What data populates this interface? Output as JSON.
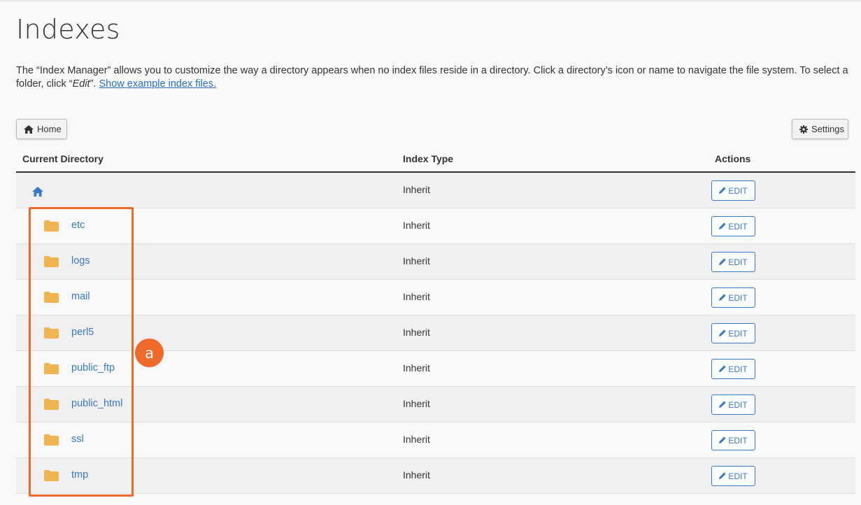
{
  "page": {
    "title": "Indexes",
    "description_line1": "The “Index Manager” allows you to customize the way a directory appears when no index files reside in a directory. Click a directory’s icon or name to navigate the file system. To select a",
    "description_line2_prefix": "folder, click “",
    "description_line2_em": "Edit",
    "description_line2_suffix": "”. ",
    "example_link": "Show example index files."
  },
  "toolbar": {
    "home_label": "Home",
    "settings_label": "Settings"
  },
  "table": {
    "headers": {
      "directory": "Current Directory",
      "index_type": "Index Type",
      "actions": "Actions"
    },
    "edit_label": "EDIT",
    "rows": [
      {
        "name": "",
        "type": "Inherit"
      },
      {
        "name": "etc",
        "type": "Inherit"
      },
      {
        "name": "logs",
        "type": "Inherit"
      },
      {
        "name": "mail",
        "type": "Inherit"
      },
      {
        "name": "perl5",
        "type": "Inherit"
      },
      {
        "name": "public_ftp",
        "type": "Inherit"
      },
      {
        "name": "public_html",
        "type": "Inherit"
      },
      {
        "name": "ssl",
        "type": "Inherit"
      },
      {
        "name": "tmp",
        "type": "Inherit"
      }
    ]
  },
  "annotation": {
    "callout_label": "a",
    "color": "#ee6a2c"
  },
  "colors": {
    "link": "#3b78c2",
    "folder": "#f0b450"
  }
}
